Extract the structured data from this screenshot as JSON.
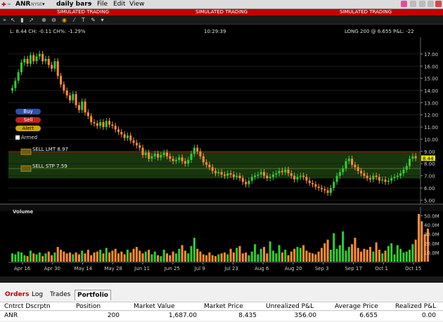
{
  "toolbar": {
    "symbol": "ANR",
    "exchange": "NYSE",
    "bar_type": "daily bars",
    "menu": [
      "File",
      "Edit",
      "View"
    ],
    "sim_label": "SIMULATED TRADING"
  },
  "chart_header": {
    "info": "L: 8.44  CH: -0.11  CH%: -1.29%",
    "time": "10:29:39",
    "position": "LONG 200 @ 6.655  P&L: -22"
  },
  "side_buttons": {
    "buy": "Buy",
    "sell": "Sell",
    "alert": "Alert",
    "armed": "Armed"
  },
  "orders": {
    "sell_limit": "SELL LMT 8.97",
    "sell_stop": "SELL STP 7.59",
    "last_price_tag": "8.44"
  },
  "volume_label": "Volume",
  "chart_data": {
    "type": "candlestick",
    "price_axis": [
      "17.00",
      "16.00",
      "15.00",
      "14.00",
      "13.00",
      "12.00",
      "11.00",
      "10.00",
      "9.00",
      "8.00",
      "7.00",
      "6.00",
      "5.00"
    ],
    "volume_axis": [
      "50.0M",
      "40.0M",
      "30.0M",
      "20.0M",
      "10.0M"
    ],
    "x_labels": [
      "Apr 16",
      "Apr 30",
      "May 14",
      "May 28",
      "Jun 11",
      "Jun 25",
      "Jul 9",
      "Jul 23",
      "Aug 6",
      "Aug 20",
      "Sep 3",
      "Sep 17",
      "Oct 1",
      "Oct 15"
    ],
    "ylim_price": [
      4.9,
      17.8
    ],
    "ylim_volume": [
      0,
      55
    ],
    "close": [
      14.2,
      14.8,
      15.5,
      16.3,
      16.6,
      16.2,
      16.9,
      16.4,
      16.8,
      17.0,
      16.4,
      16.6,
      16.1,
      15.8,
      16.4,
      15.2,
      14.5,
      14.0,
      13.6,
      13.2,
      13.7,
      12.8,
      12.4,
      13.1,
      12.2,
      11.9,
      11.4,
      11.3,
      11.1,
      11.4,
      11.0,
      11.5,
      11.2,
      11.1,
      10.8,
      10.6,
      10.4,
      10.1,
      10.3,
      9.9,
      9.7,
      9.5,
      9.3,
      8.7,
      8.9,
      8.4,
      8.6,
      8.8,
      8.5,
      8.7,
      8.9,
      8.6,
      8.4,
      8.2,
      8.3,
      8.5,
      8.2,
      8.0,
      8.3,
      8.8,
      9.3,
      9.0,
      8.6,
      8.1,
      7.9,
      7.7,
      7.4,
      7.2,
      7.3,
      7.1,
      7.0,
      7.2,
      7.1,
      6.9,
      7.0,
      6.8,
      6.5,
      6.3,
      6.6,
      6.9,
      7.0,
      7.1,
      7.3,
      7.0,
      6.8,
      6.9,
      7.1,
      7.2,
      7.4,
      7.3,
      7.5,
      7.2,
      7.0,
      6.7,
      6.9,
      7.0,
      6.9,
      6.6,
      6.4,
      6.3,
      6.1,
      6.0,
      5.9,
      5.8,
      5.6,
      6.0,
      6.5,
      7.0,
      7.3,
      7.6,
      8.2,
      8.4,
      7.9,
      7.7,
      7.4,
      7.2,
      7.0,
      6.8,
      6.7,
      7.0,
      6.9,
      6.6,
      6.7,
      6.5,
      6.6,
      6.8,
      6.9,
      7.0,
      7.2,
      7.5,
      7.8,
      8.4,
      8.6,
      8.44
    ],
    "volume": [
      9,
      8,
      11,
      10,
      7,
      6,
      12,
      9,
      8,
      10,
      6,
      9,
      11,
      7,
      10,
      16,
      13,
      11,
      9,
      10,
      8,
      10,
      8,
      12,
      9,
      13,
      7,
      10,
      11,
      13,
      9,
      15,
      10,
      12,
      14,
      9,
      11,
      8,
      13,
      10,
      14,
      16,
      12,
      9,
      11,
      13,
      8,
      11,
      7,
      6,
      13,
      9,
      7,
      11,
      9,
      14,
      18,
      12,
      9,
      17,
      26,
      14,
      11,
      8,
      7,
      10,
      7,
      6,
      8,
      9,
      10,
      8,
      14,
      10,
      15,
      17,
      9,
      10,
      7,
      11,
      19,
      8,
      14,
      16,
      9,
      22,
      12,
      9,
      18,
      10,
      13,
      7,
      11,
      14,
      16,
      15,
      18,
      12,
      10,
      9,
      8,
      11,
      15,
      20,
      24,
      13,
      31,
      14,
      18,
      33,
      12,
      16,
      19,
      26,
      15,
      11,
      14,
      13,
      16,
      11,
      21,
      13,
      9,
      12,
      17,
      20,
      8,
      18,
      14,
      10,
      11,
      13,
      19,
      24,
      52,
      44,
      30,
      36
    ]
  },
  "portfolio": {
    "tabs": [
      "Orders",
      "Log",
      "Trades",
      "Portfolio"
    ],
    "columns": [
      "Cntrct Dscrptn",
      "Position",
      "Market Value",
      "Market Price",
      "Unrealized P&L",
      "Average Price",
      "Realized P&L"
    ],
    "rows": [
      [
        "ANR",
        "200",
        "1,687.00",
        "8.435",
        "356.00",
        "6.655",
        "0.00"
      ]
    ]
  },
  "colors": {
    "up": "#33cc33",
    "down": "#ff8c33",
    "limit_line": "#cc0000",
    "stop_zone": "#1f4a12"
  }
}
